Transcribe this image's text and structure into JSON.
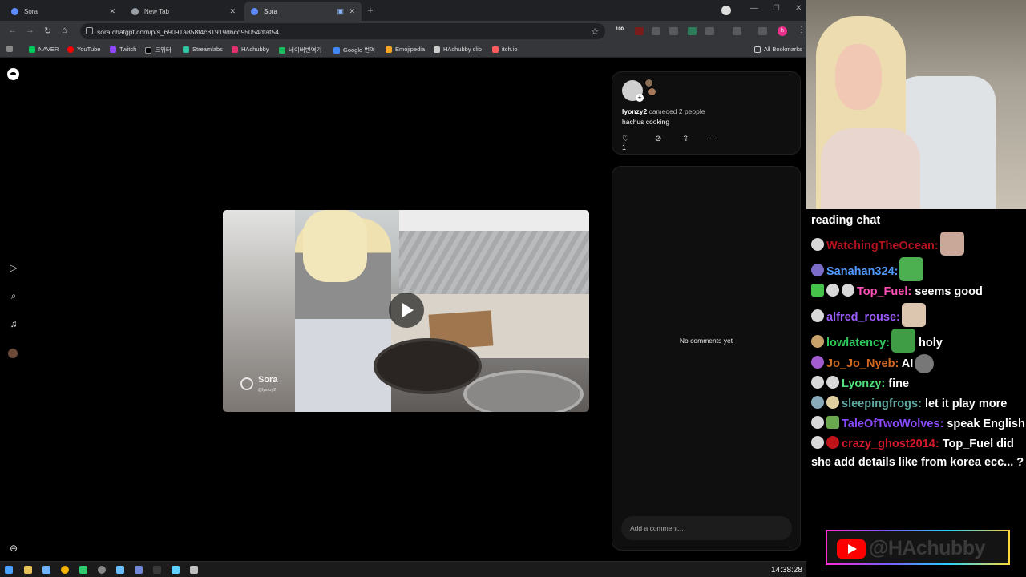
{
  "browser": {
    "tabs": [
      {
        "label": "Sora",
        "active": false
      },
      {
        "label": "New Tab",
        "active": false
      },
      {
        "label": "Sora",
        "active": true
      }
    ],
    "url": "sora.chatgpt.com/p/s_69091a858f4c81919d6cd95054dfaf54",
    "ext_badge": "100",
    "profile_initial": "h",
    "bookmarks": [
      "NAVER",
      "YouTube",
      "Twitch",
      "트위터",
      "Streamlabs",
      "HAchubby",
      "네이버번역기",
      "Google 번역",
      "Emojipedia",
      "HAchubby clip",
      "itch.io"
    ],
    "all_bookmarks": "All Bookmarks"
  },
  "sora": {
    "video": {
      "watermark": "Sora",
      "watermark_user": "@lyonzy2"
    },
    "post": {
      "username": "lyonzy2",
      "cameo_text": "cameoed 2 people",
      "caption": "hachus cooking",
      "likes": "1"
    },
    "comments": {
      "empty_text": "No comments yet",
      "placeholder": "Add a comment..."
    }
  },
  "taskbar": {
    "clock": "14:38:28"
  },
  "stream": {
    "chat_header": "reading chat",
    "messages": [
      {
        "user": "WatchingTheOcean",
        "color": "#b3121f",
        "text": ""
      },
      {
        "user": "Sanahan324",
        "color": "#4f9bff",
        "text": ""
      },
      {
        "user": "Top_Fuel",
        "color": "#ff4fb4",
        "text": "seems good"
      },
      {
        "user": "alfred_rouse",
        "color": "#9b5cff",
        "text": ""
      },
      {
        "user": "lowlatency",
        "color": "#2ec95c",
        "text": "holy"
      },
      {
        "user": "Jo_Jo_Nyeb",
        "color": "#d2691e",
        "text": "AI"
      },
      {
        "user": "Lyonzy",
        "color": "#4fe07a",
        "text": "fine"
      },
      {
        "user": "sleepingfrogs",
        "color": "#5fa8a0",
        "text": "let it play more"
      },
      {
        "user": "TaleOfTwoWolves",
        "color": "#8a4bff",
        "text": "speak English"
      },
      {
        "user": "crazy_ghost2014",
        "color": "#d3192a",
        "text": "Top_Fuel did she add details like from korea ecc... ?"
      }
    ],
    "youtube_handle": "@HAchubby"
  }
}
